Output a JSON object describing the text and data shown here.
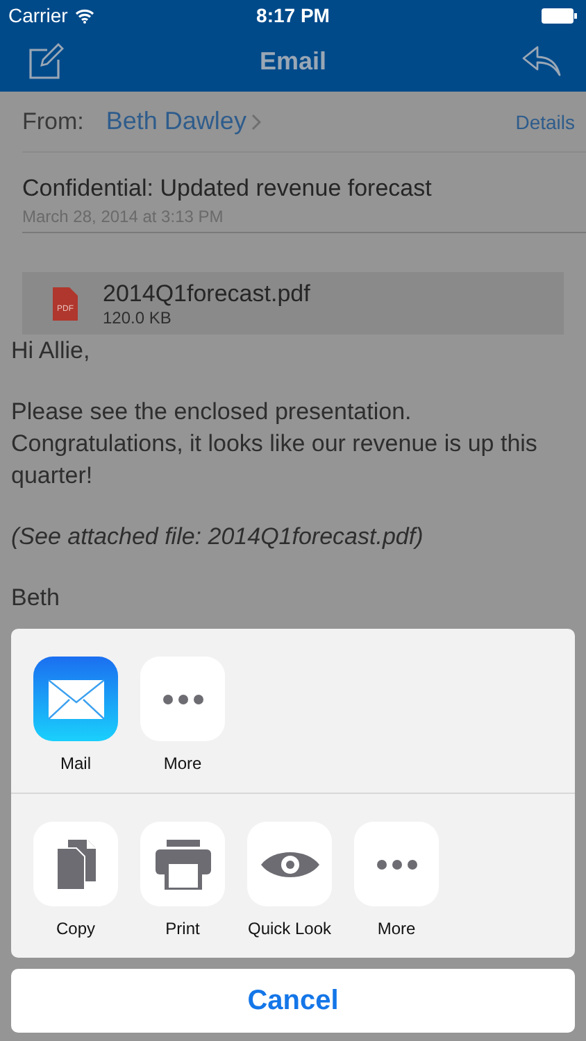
{
  "status_bar": {
    "carrier": "Carrier",
    "time": "8:17 PM"
  },
  "nav_bar": {
    "title": "Email"
  },
  "email": {
    "from_label": "From:",
    "sender": "Beth Dawley",
    "details": "Details",
    "subject": "Confidential: Updated revenue forecast",
    "date": "March 28, 2014 at 3:13 PM",
    "attachment": {
      "name": "2014Q1forecast.pdf",
      "size": "120.0 KB",
      "badge": "PDF"
    },
    "body": [
      {
        "kind": "plain",
        "text": "Hi Allie,"
      },
      {
        "kind": "plain",
        "text": "Please see the enclosed presentation. Congratulations, it looks like our revenue is up this quarter!"
      },
      {
        "kind": "italic",
        "text": "(See attached file: 2014Q1forecast.pdf)"
      },
      {
        "kind": "plain",
        "text": "Beth"
      }
    ]
  },
  "share_sheet": {
    "apps": [
      {
        "kind": "mail",
        "label": "Mail"
      },
      {
        "kind": "more",
        "label": "More"
      }
    ],
    "actions": [
      {
        "kind": "copy",
        "label": "Copy"
      },
      {
        "kind": "print",
        "label": "Print"
      },
      {
        "kind": "eye",
        "label": "Quick Look"
      },
      {
        "kind": "more",
        "label": "More"
      }
    ],
    "cancel": "Cancel"
  }
}
